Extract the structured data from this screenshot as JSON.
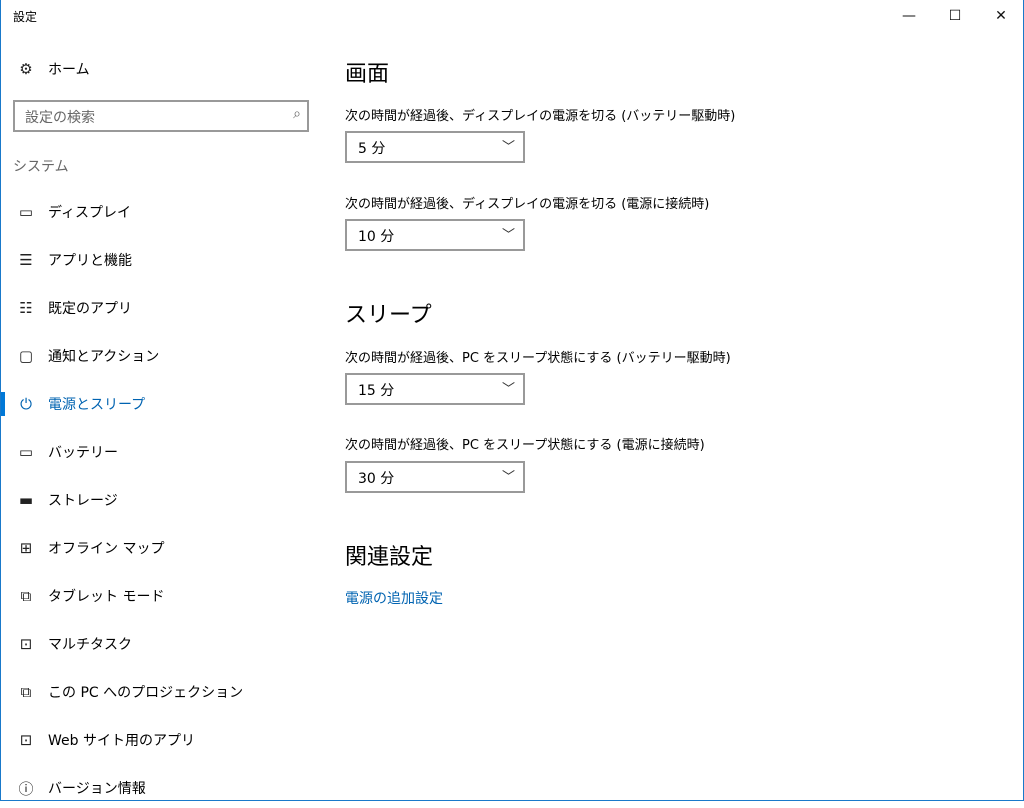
{
  "window": {
    "title": "設定",
    "minimize": "—",
    "maximize": "☐",
    "close": "✕"
  },
  "sidebar": {
    "home": "ホーム",
    "search_placeholder": "設定の検索",
    "section": "システム",
    "items": [
      {
        "label": "ディスプレイ",
        "icon": "monitor-icon",
        "glyph": "▭"
      },
      {
        "label": "アプリと機能",
        "icon": "list-icon",
        "glyph": "☰"
      },
      {
        "label": "既定のアプリ",
        "icon": "default-apps-icon",
        "glyph": "☷"
      },
      {
        "label": "通知とアクション",
        "icon": "message-icon",
        "glyph": "▢"
      },
      {
        "label": "電源とスリープ",
        "icon": "power-icon",
        "glyph": "⏻"
      },
      {
        "label": "バッテリー",
        "icon": "battery-icon",
        "glyph": "▭"
      },
      {
        "label": "ストレージ",
        "icon": "storage-icon",
        "glyph": "▬"
      },
      {
        "label": "オフライン マップ",
        "icon": "map-icon",
        "glyph": "⊞"
      },
      {
        "label": "タブレット モード",
        "icon": "tablet-icon",
        "glyph": "⧉"
      },
      {
        "label": "マルチタスク",
        "icon": "multitask-icon",
        "glyph": "⊡"
      },
      {
        "label": "この PC へのプロジェクション",
        "icon": "projection-icon",
        "glyph": "⧉"
      },
      {
        "label": "Web サイト用のアプリ",
        "icon": "web-apps-icon",
        "glyph": "⊡"
      },
      {
        "label": "バージョン情報",
        "icon": "info-icon",
        "glyph": "ⓘ"
      }
    ]
  },
  "main": {
    "screen_heading": "画面",
    "screen_battery_label": "次の時間が経過後、ディスプレイの電源を切る (バッテリー駆動時)",
    "screen_battery_value": "5 分",
    "screen_plugged_label": "次の時間が経過後、ディスプレイの電源を切る (電源に接続時)",
    "screen_plugged_value": "10 分",
    "sleep_heading": "スリープ",
    "sleep_battery_label": "次の時間が経過後、PC をスリープ状態にする (バッテリー駆動時)",
    "sleep_battery_value": "15 分",
    "sleep_plugged_label": "次の時間が経過後、PC をスリープ状態にする (電源に接続時)",
    "sleep_plugged_value": "30 分",
    "related_heading": "関連設定",
    "related_link": "電源の追加設定"
  },
  "colors": {
    "accent": "#0078d7",
    "link": "#0063b1"
  }
}
